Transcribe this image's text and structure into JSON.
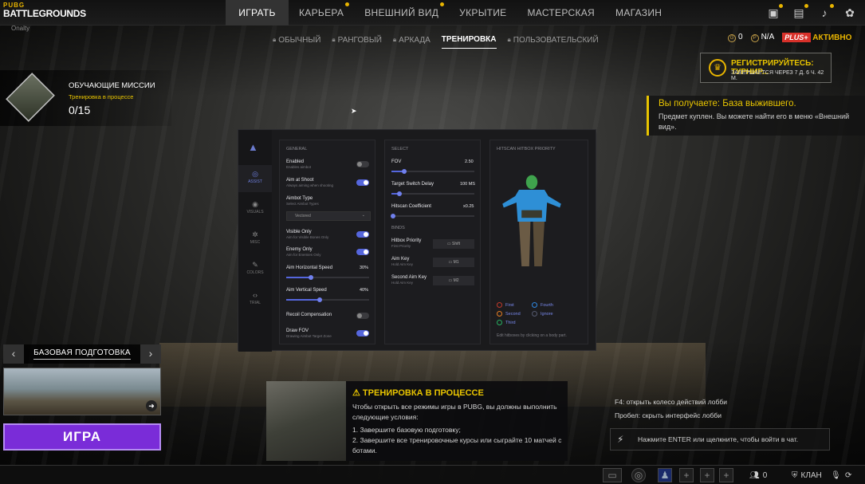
{
  "header": {
    "logo_top": "PUBG",
    "logo_main": "BATTLEGROUNDS",
    "logo_sub": "Onalty",
    "tabs": [
      {
        "label": "ИГРАТЬ",
        "active": true
      },
      {
        "label": "КАРЬЕРА",
        "badge": true
      },
      {
        "label": "ВНЕШНИЙ ВИД",
        "badge": true
      },
      {
        "label": "УКРЫТИЕ"
      },
      {
        "label": "МАСТЕРСКАЯ"
      },
      {
        "label": "МАГАЗИН"
      }
    ],
    "icons": [
      "store-icon",
      "mail-icon",
      "bell-icon",
      "gear-icon"
    ]
  },
  "modes": [
    {
      "label": "ОБЫЧНЫЙ",
      "locked": true
    },
    {
      "label": "РАНГОВЫЙ",
      "locked": true
    },
    {
      "label": "АРКАДА",
      "locked": true
    },
    {
      "label": "ТРЕНИРОВКА",
      "active": true
    },
    {
      "label": "ПОЛЬЗОВАТЕЛЬСКИЙ",
      "locked": true
    }
  ],
  "currency": {
    "coins": "0",
    "bp": "N/A",
    "plus_badge": "PLUS+",
    "plus_status": "АКТИВНО"
  },
  "tournament": {
    "title": "РЕГИСТРИРУЙТЕСЬ: ТУРНИР...",
    "subtitle": "ЗАВЕРШАЕТСЯ ЧЕРЕЗ 7 Д. 6 Ч. 42 М."
  },
  "reward": {
    "title": "Вы получаете: База выжившего.",
    "text": "Предмет куплен. Вы можете найти его в меню «Внешний вид»."
  },
  "missions": {
    "title": "ОБУЧАЮЩИЕ МИССИИ",
    "status": "Тренировка в процессе",
    "progress": "0/15"
  },
  "cheat": {
    "sidebar": [
      {
        "label": "ASSIST",
        "icon": "crosshair-icon",
        "active": true
      },
      {
        "label": "VISUALS",
        "icon": "eye-icon"
      },
      {
        "label": "MISC",
        "icon": "gear-icon"
      },
      {
        "label": "COLORS",
        "icon": "pen-icon"
      },
      {
        "label": "TRIAL",
        "icon": "code-icon"
      }
    ],
    "general": {
      "title": "GENERAL",
      "enabled": {
        "name": "Enabled",
        "desc": "Enables aimbot",
        "on": false
      },
      "aim_at_shoot": {
        "name": "Aim at Shoot",
        "desc": "Always aiming when shooting",
        "on": true
      },
      "aimbot_type": {
        "name": "Aimbot Type",
        "desc": "Select Aimbot Types",
        "value": "Vectored"
      },
      "visible_only": {
        "name": "Visible Only",
        "desc": "Aim for Visible Bones Only",
        "on": true
      },
      "enemy_only": {
        "name": "Enemy Only",
        "desc": "Aim for Enemies Only",
        "on": true
      },
      "aim_h_speed": {
        "name": "Aim Horizontal Speed",
        "value": "30%",
        "fraction": 0.3
      },
      "aim_v_speed": {
        "name": "Aim Vertical Speed",
        "value": "40%",
        "fraction": 0.4
      },
      "recoil": {
        "name": "Recoil Compensation",
        "on": false
      },
      "draw_fov": {
        "name": "Draw FOV",
        "desc": "Drawing Aimbot Target Zone",
        "on": true
      }
    },
    "select": {
      "title": "SELECT",
      "fov": {
        "name": "FOV",
        "value": "2.50",
        "fraction": 0.15
      },
      "switch_delay": {
        "name": "Target Switch Delay",
        "value": "100 MS",
        "fraction": 0.1
      },
      "hitscan": {
        "name": "Hitscan Coefficient",
        "value": "x0.25",
        "fraction": 0.02
      }
    },
    "binds": {
      "title": "BINDS",
      "hitbox_priority": {
        "name": "Hitbox Priority",
        "desc": "First Priority",
        "key": "Shift"
      },
      "aim_key": {
        "name": "Aim Key",
        "desc": "Hold Aim Key",
        "key": "M1"
      },
      "second_aim_key": {
        "name": "Second Aim Key",
        "desc": "Hold Aim Key",
        "key": "M2"
      }
    },
    "hitscan_panel": {
      "title": "HITSCAN HITBOX PRIORITY",
      "legend": [
        {
          "label": "First",
          "color": "#c0392b"
        },
        {
          "label": "Fourth",
          "color": "#2e86de"
        },
        {
          "label": "Second",
          "color": "#e67e22"
        },
        {
          "label": "Ignore",
          "color": "#555a70"
        },
        {
          "label": "Third",
          "color": "#27ae60"
        }
      ],
      "hint": "Edit hitboxes by clicking on a body part."
    }
  },
  "map": {
    "name": "БАЗОВАЯ ПОДГОТОВКА",
    "play_label": "ИГРА"
  },
  "training": {
    "title": "ТРЕНИРОВКА В ПРОЦЕССЕ",
    "line1": "Чтобы открыть все режимы игры в PUBG, вы должны выполнить следующие условия:",
    "line2": "1. Завершите базовую подготовку;",
    "line3": "2. Завершите все тренировочные курсы или сыграйте 10 матчей с ботами."
  },
  "chat": {
    "line1": "F4: открыть колесо действий лобби",
    "line2": "Пробел: скрыть интерфейс лобби",
    "placeholder": "Нажмите ENTER или щелкните, чтобы войти в чат."
  },
  "bottom": {
    "friends_count": "0",
    "clan_label": "КЛАН"
  }
}
